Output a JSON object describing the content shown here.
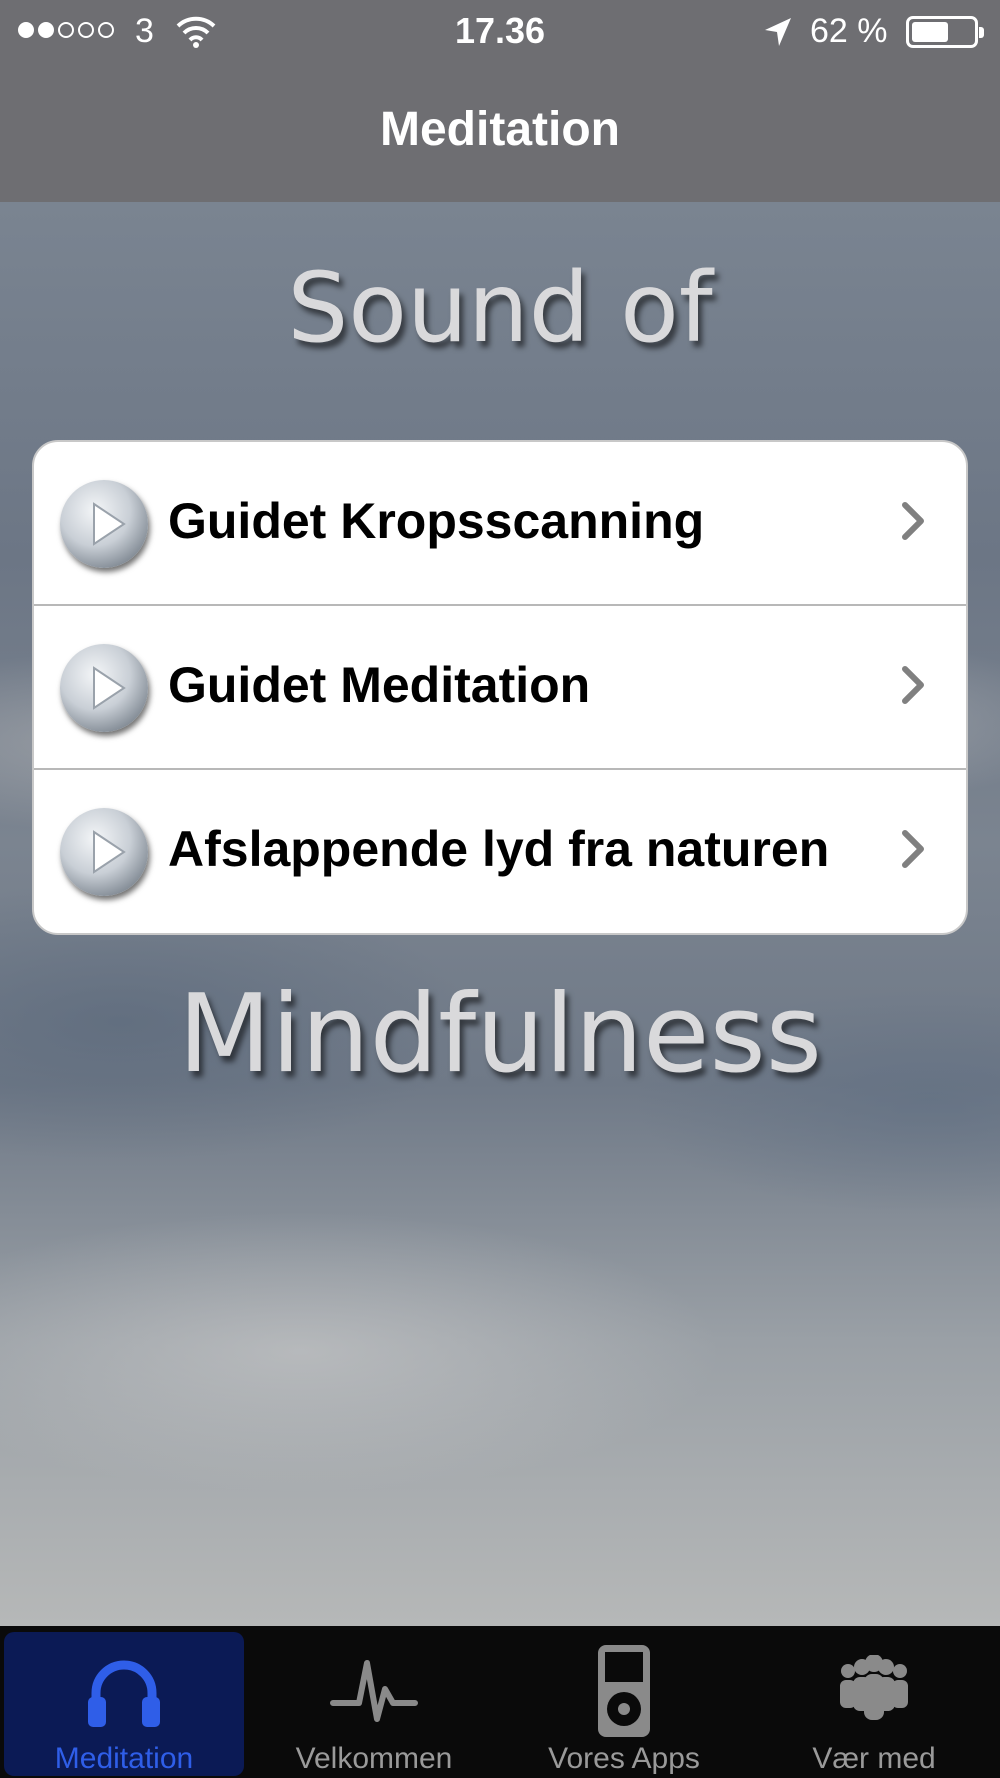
{
  "status_bar": {
    "signal_bars_filled": 2,
    "signal_bars_total": 5,
    "carrier": "3",
    "time": "17.36",
    "battery_percent_text": "62 %",
    "battery_level": 0.62
  },
  "nav": {
    "title": "Meditation"
  },
  "content": {
    "headline_top": "Sound of",
    "headline_bottom": "Mindfulness",
    "items": [
      {
        "label": "Guidet Kropsscanning"
      },
      {
        "label": "Guidet Meditation"
      },
      {
        "label": "Afslappende lyd fra naturen"
      }
    ]
  },
  "tabs": [
    {
      "label": "Meditation",
      "icon": "headphones-icon",
      "active": true
    },
    {
      "label": "Velkommen",
      "icon": "heartbeat-icon",
      "active": false
    },
    {
      "label": "Vores Apps",
      "icon": "ipod-icon",
      "active": false
    },
    {
      "label": "Vær med",
      "icon": "people-icon",
      "active": false
    }
  ],
  "colors": {
    "active_tab": "#2f5ee8",
    "bar_bg": "#6e6e72",
    "tabbar_bg": "#0a0a0a"
  }
}
